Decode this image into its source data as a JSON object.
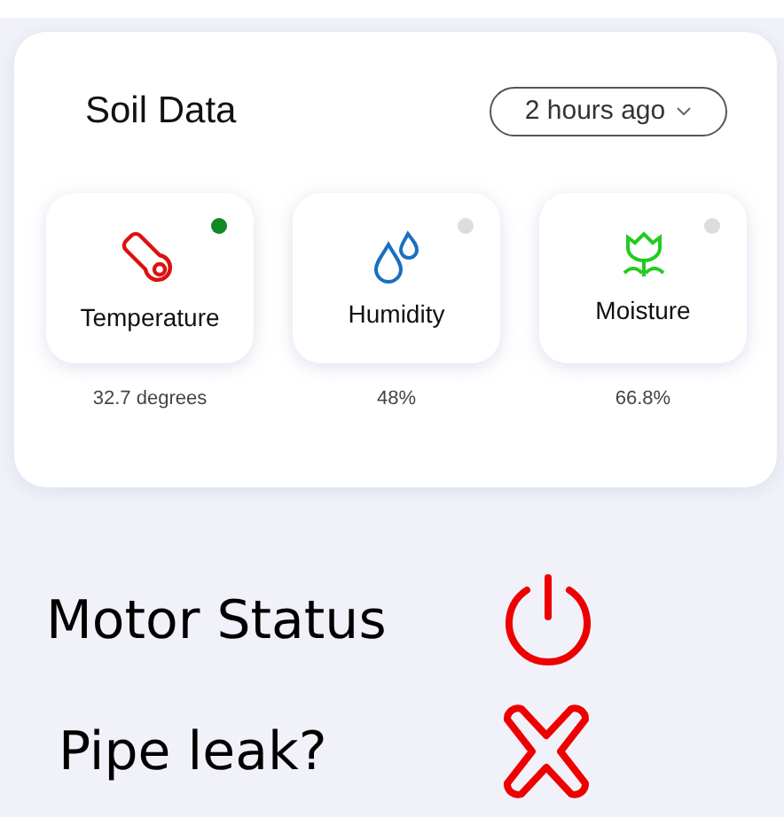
{
  "card": {
    "title": "Soil Data",
    "range": {
      "value": "2 hours ago"
    },
    "sensors": [
      {
        "kind": "thermometer",
        "label": "Temperature",
        "reading": "32.7 degrees",
        "active": true
      },
      {
        "kind": "drops",
        "label": "Humidity",
        "reading": "48%",
        "active": false
      },
      {
        "kind": "plant",
        "label": "Moisture",
        "reading": "66.8%",
        "active": false
      }
    ]
  },
  "statuses": [
    {
      "kind": "power",
      "label": "Motor Status"
    },
    {
      "kind": "cross",
      "label": "Pipe leak?"
    }
  ]
}
